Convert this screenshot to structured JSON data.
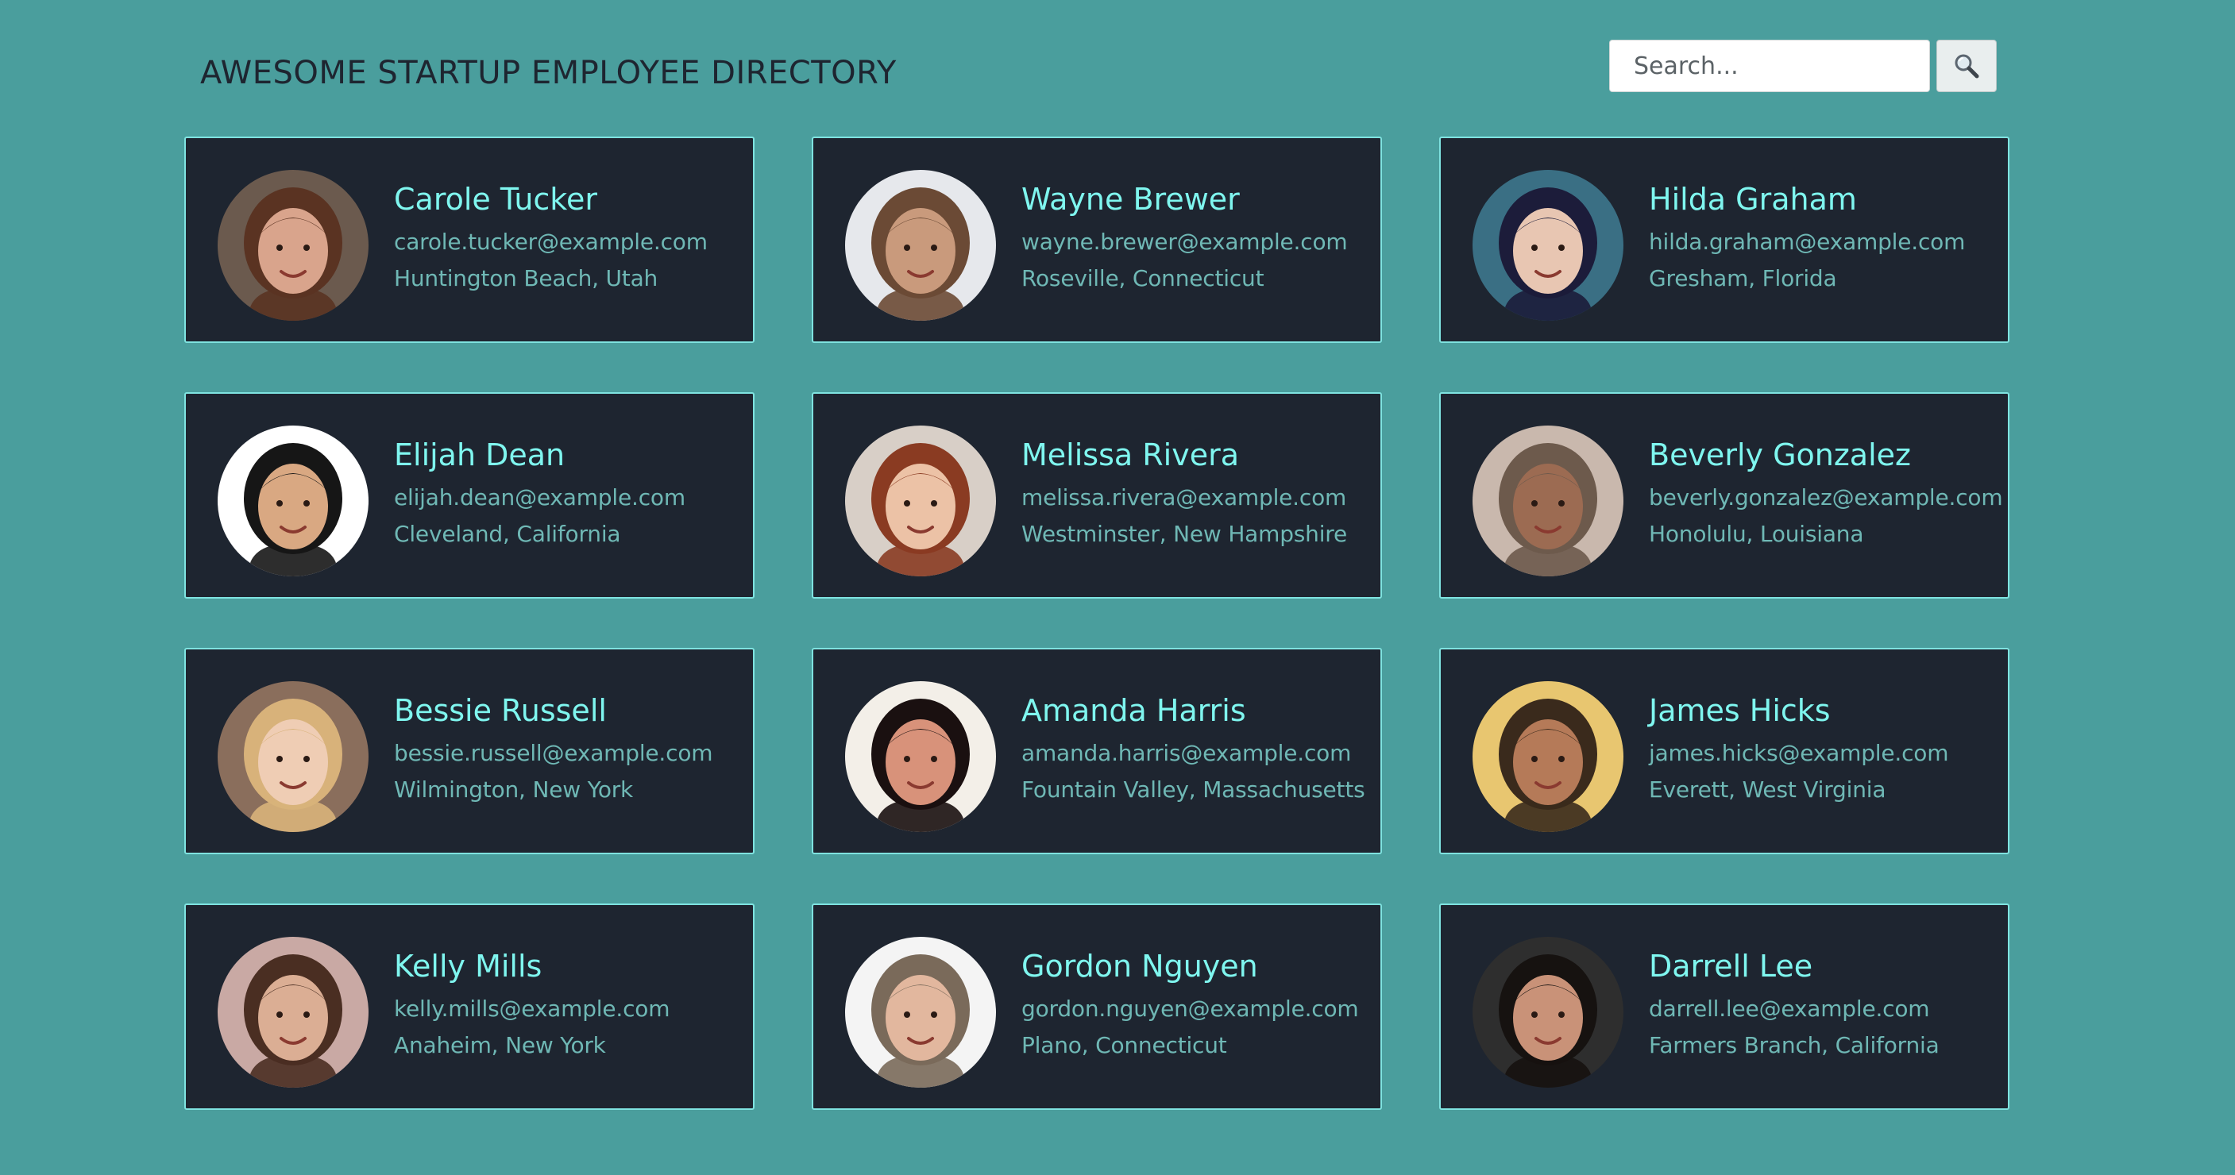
{
  "header": {
    "title": "AWESOME STARTUP EMPLOYEE DIRECTORY",
    "search_placeholder": "Search...",
    "search_button_icon": "magnifying-glass-icon"
  },
  "colors": {
    "background": "#4a9e9d",
    "card_bg": "#1e2530",
    "card_border": "#7fe3e0",
    "name": "#7ff6ef",
    "detail": "#6fb8b5"
  },
  "employees": [
    {
      "name": "Carole Tucker",
      "email": "carole.tucker@example.com",
      "location": "Huntington Beach, Utah",
      "photo_bg": "#6b5a4e",
      "skin": "#d9a48c",
      "hair": "#5a3322"
    },
    {
      "name": "Wayne Brewer",
      "email": "wayne.brewer@example.com",
      "location": "Roseville, Connecticut",
      "photo_bg": "#e6e8ec",
      "skin": "#c99a7c",
      "hair": "#6b4a35"
    },
    {
      "name": "Hilda Graham",
      "email": "hilda.graham@example.com",
      "location": "Gresham, Florida",
      "photo_bg": "#3a6f84",
      "skin": "#e8c6b2",
      "hair": "#1c1c3a"
    },
    {
      "name": "Elijah Dean",
      "email": "elijah.dean@example.com",
      "location": "Cleveland, California",
      "photo_bg": "#ffffff",
      "skin": "#d9a882",
      "hair": "#161616"
    },
    {
      "name": "Melissa Rivera",
      "email": "melissa.rivera@example.com",
      "location": "Westminster, New Hampshire",
      "photo_bg": "#d8cfc7",
      "skin": "#ecc2a6",
      "hair": "#8a3b22"
    },
    {
      "name": "Beverly Gonzalez",
      "email": "beverly.gonzalez@example.com",
      "location": "Honolulu, Louisiana",
      "photo_bg": "#c9b8ad",
      "skin": "#9c6b52",
      "hair": "#6d5a4c"
    },
    {
      "name": "Bessie Russell",
      "email": "bessie.russell@example.com",
      "location": "Wilmington, New York",
      "photo_bg": "#8a6e5c",
      "skin": "#efcdb4",
      "hair": "#d8b27a"
    },
    {
      "name": "Amanda Harris",
      "email": "amanda.harris@example.com",
      "location": "Fountain Valley, Massachusetts",
      "photo_bg": "#f3efe8",
      "skin": "#d8927a",
      "hair": "#1a1010"
    },
    {
      "name": "James Hicks",
      "email": "james.hicks@example.com",
      "location": "Everett, West Virginia",
      "photo_bg": "#e8c670",
      "skin": "#b57a58",
      "hair": "#3a2a1c"
    },
    {
      "name": "Kelly Mills",
      "email": "kelly.mills@example.com",
      "location": "Anaheim, New York",
      "photo_bg": "#c9a9a4",
      "skin": "#dbae94",
      "hair": "#4a2e22"
    },
    {
      "name": "Gordon Nguyen",
      "email": "gordon.nguyen@example.com",
      "location": "Plano, Connecticut",
      "photo_bg": "#f4f4f4",
      "skin": "#e2b79e",
      "hair": "#7a6a5a"
    },
    {
      "name": "Darrell Lee",
      "email": "darrell.lee@example.com",
      "location": "Farmers Branch, California",
      "photo_bg": "#2e2e2e",
      "skin": "#c99278",
      "hair": "#161210"
    }
  ]
}
